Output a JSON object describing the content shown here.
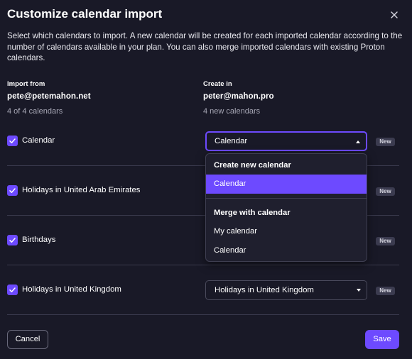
{
  "modal": {
    "title": "Customize calendar import",
    "description": "Select which calendars to import. A new calendar will be created for each imported calendar according to the number of calendars available in your plan. You can also merge imported calendars with existing Proton calendars."
  },
  "import_from": {
    "heading": "Import from",
    "account": "pete@petemahon.net",
    "count": "4 of 4 calendars"
  },
  "create_in": {
    "heading": "Create in",
    "account": "peter@mahon.pro",
    "count": "4 new calendars"
  },
  "rows": [
    {
      "label": "Calendar",
      "checked": true,
      "select_value": "Calendar",
      "badge": "New"
    },
    {
      "label": "Holidays in United Arab Emirates",
      "checked": true,
      "select_value": "",
      "badge": "New"
    },
    {
      "label": "Birthdays",
      "checked": true,
      "select_value": "",
      "badge": "New"
    },
    {
      "label": "Holidays in United Kingdom",
      "checked": true,
      "select_value": "Holidays in United Kingdom",
      "badge": "New"
    }
  ],
  "dropdown": {
    "create_heading": "Create new calendar",
    "create_options": [
      "Calendar"
    ],
    "selected": "Calendar",
    "merge_heading": "Merge with calendar",
    "merge_options": [
      "My calendar",
      "Calendar"
    ]
  },
  "footer": {
    "cancel_label": "Cancel",
    "save_label": "Save"
  },
  "colors": {
    "background": "#191927",
    "accent": "#6d4aff",
    "badge_bg": "#3b3b4f",
    "divider": "#3a3a4d"
  },
  "icons": {
    "close": "close-icon",
    "checkbox": "checkmark-icon",
    "select_open": "caret-up-icon",
    "select_closed": "caret-down-icon"
  }
}
